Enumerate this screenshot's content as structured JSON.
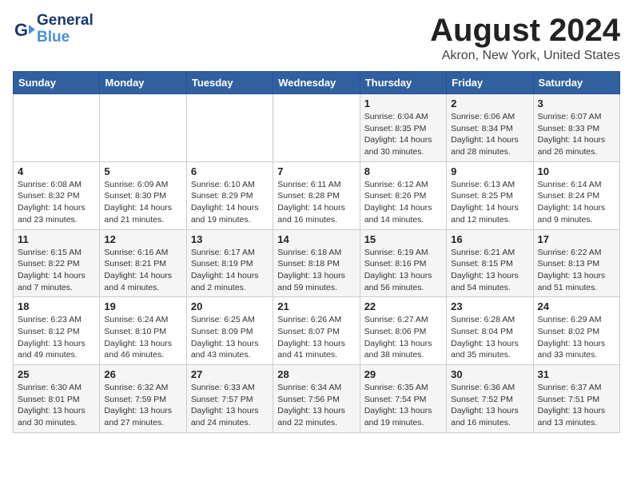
{
  "header": {
    "logo_line1": "General",
    "logo_line2": "Blue",
    "month_year": "August 2024",
    "location": "Akron, New York, United States"
  },
  "weekdays": [
    "Sunday",
    "Monday",
    "Tuesday",
    "Wednesday",
    "Thursday",
    "Friday",
    "Saturday"
  ],
  "weeks": [
    [
      {
        "day": "",
        "info": ""
      },
      {
        "day": "",
        "info": ""
      },
      {
        "day": "",
        "info": ""
      },
      {
        "day": "",
        "info": ""
      },
      {
        "day": "1",
        "info": "Sunrise: 6:04 AM\nSunset: 8:35 PM\nDaylight: 14 hours and 30 minutes."
      },
      {
        "day": "2",
        "info": "Sunrise: 6:06 AM\nSunset: 8:34 PM\nDaylight: 14 hours and 28 minutes."
      },
      {
        "day": "3",
        "info": "Sunrise: 6:07 AM\nSunset: 8:33 PM\nDaylight: 14 hours and 26 minutes."
      }
    ],
    [
      {
        "day": "4",
        "info": "Sunrise: 6:08 AM\nSunset: 8:32 PM\nDaylight: 14 hours and 23 minutes."
      },
      {
        "day": "5",
        "info": "Sunrise: 6:09 AM\nSunset: 8:30 PM\nDaylight: 14 hours and 21 minutes."
      },
      {
        "day": "6",
        "info": "Sunrise: 6:10 AM\nSunset: 8:29 PM\nDaylight: 14 hours and 19 minutes."
      },
      {
        "day": "7",
        "info": "Sunrise: 6:11 AM\nSunset: 8:28 PM\nDaylight: 14 hours and 16 minutes."
      },
      {
        "day": "8",
        "info": "Sunrise: 6:12 AM\nSunset: 8:26 PM\nDaylight: 14 hours and 14 minutes."
      },
      {
        "day": "9",
        "info": "Sunrise: 6:13 AM\nSunset: 8:25 PM\nDaylight: 14 hours and 12 minutes."
      },
      {
        "day": "10",
        "info": "Sunrise: 6:14 AM\nSunset: 8:24 PM\nDaylight: 14 hours and 9 minutes."
      }
    ],
    [
      {
        "day": "11",
        "info": "Sunrise: 6:15 AM\nSunset: 8:22 PM\nDaylight: 14 hours and 7 minutes."
      },
      {
        "day": "12",
        "info": "Sunrise: 6:16 AM\nSunset: 8:21 PM\nDaylight: 14 hours and 4 minutes."
      },
      {
        "day": "13",
        "info": "Sunrise: 6:17 AM\nSunset: 8:19 PM\nDaylight: 14 hours and 2 minutes."
      },
      {
        "day": "14",
        "info": "Sunrise: 6:18 AM\nSunset: 8:18 PM\nDaylight: 13 hours and 59 minutes."
      },
      {
        "day": "15",
        "info": "Sunrise: 6:19 AM\nSunset: 8:16 PM\nDaylight: 13 hours and 56 minutes."
      },
      {
        "day": "16",
        "info": "Sunrise: 6:21 AM\nSunset: 8:15 PM\nDaylight: 13 hours and 54 minutes."
      },
      {
        "day": "17",
        "info": "Sunrise: 6:22 AM\nSunset: 8:13 PM\nDaylight: 13 hours and 51 minutes."
      }
    ],
    [
      {
        "day": "18",
        "info": "Sunrise: 6:23 AM\nSunset: 8:12 PM\nDaylight: 13 hours and 49 minutes."
      },
      {
        "day": "19",
        "info": "Sunrise: 6:24 AM\nSunset: 8:10 PM\nDaylight: 13 hours and 46 minutes."
      },
      {
        "day": "20",
        "info": "Sunrise: 6:25 AM\nSunset: 8:09 PM\nDaylight: 13 hours and 43 minutes."
      },
      {
        "day": "21",
        "info": "Sunrise: 6:26 AM\nSunset: 8:07 PM\nDaylight: 13 hours and 41 minutes."
      },
      {
        "day": "22",
        "info": "Sunrise: 6:27 AM\nSunset: 8:06 PM\nDaylight: 13 hours and 38 minutes."
      },
      {
        "day": "23",
        "info": "Sunrise: 6:28 AM\nSunset: 8:04 PM\nDaylight: 13 hours and 35 minutes."
      },
      {
        "day": "24",
        "info": "Sunrise: 6:29 AM\nSunset: 8:02 PM\nDaylight: 13 hours and 33 minutes."
      }
    ],
    [
      {
        "day": "25",
        "info": "Sunrise: 6:30 AM\nSunset: 8:01 PM\nDaylight: 13 hours and 30 minutes."
      },
      {
        "day": "26",
        "info": "Sunrise: 6:32 AM\nSunset: 7:59 PM\nDaylight: 13 hours and 27 minutes."
      },
      {
        "day": "27",
        "info": "Sunrise: 6:33 AM\nSunset: 7:57 PM\nDaylight: 13 hours and 24 minutes."
      },
      {
        "day": "28",
        "info": "Sunrise: 6:34 AM\nSunset: 7:56 PM\nDaylight: 13 hours and 22 minutes."
      },
      {
        "day": "29",
        "info": "Sunrise: 6:35 AM\nSunset: 7:54 PM\nDaylight: 13 hours and 19 minutes."
      },
      {
        "day": "30",
        "info": "Sunrise: 6:36 AM\nSunset: 7:52 PM\nDaylight: 13 hours and 16 minutes."
      },
      {
        "day": "31",
        "info": "Sunrise: 6:37 AM\nSunset: 7:51 PM\nDaylight: 13 hours and 13 minutes."
      }
    ]
  ]
}
